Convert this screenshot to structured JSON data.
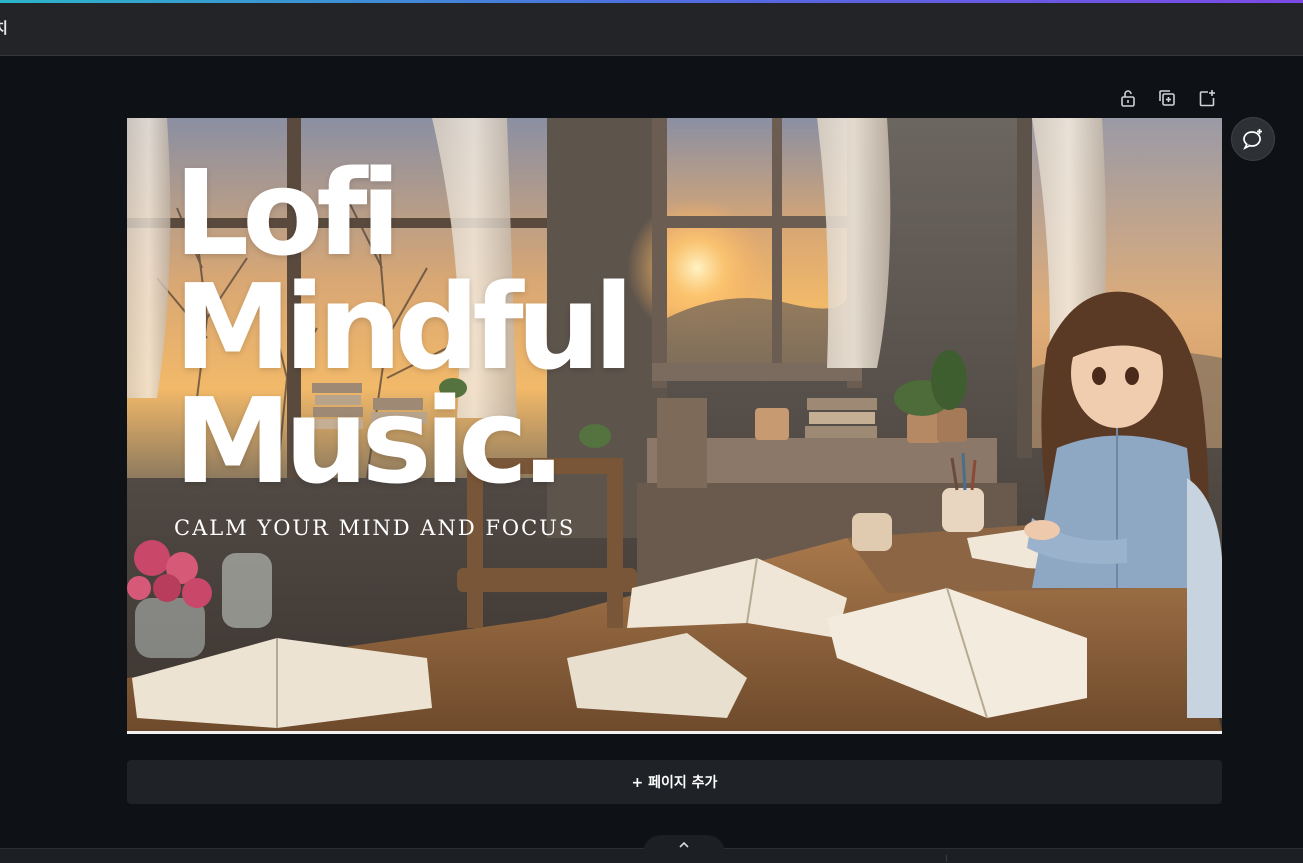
{
  "topbar": {
    "title": "치"
  },
  "toolbar": {
    "icons": [
      "unlock-icon",
      "duplicate-page-icon",
      "add-page-icon"
    ]
  },
  "comment": {
    "icon": "add-comment-icon"
  },
  "design": {
    "headline": "Lofi\nMindful\nMusic.",
    "tagline": "CALM YOUR MIND AND FOCUS"
  },
  "add_page": {
    "label": "+ 페이지 추가"
  },
  "bottom": {
    "collapse_icon": "chevron-up-icon"
  },
  "colors": {
    "background": "#0e1216",
    "topbar": "#222428",
    "accent_gradient": [
      "#2bb5c9",
      "#4e6ee0",
      "#7d4ae6"
    ],
    "button": "#1f2328"
  }
}
